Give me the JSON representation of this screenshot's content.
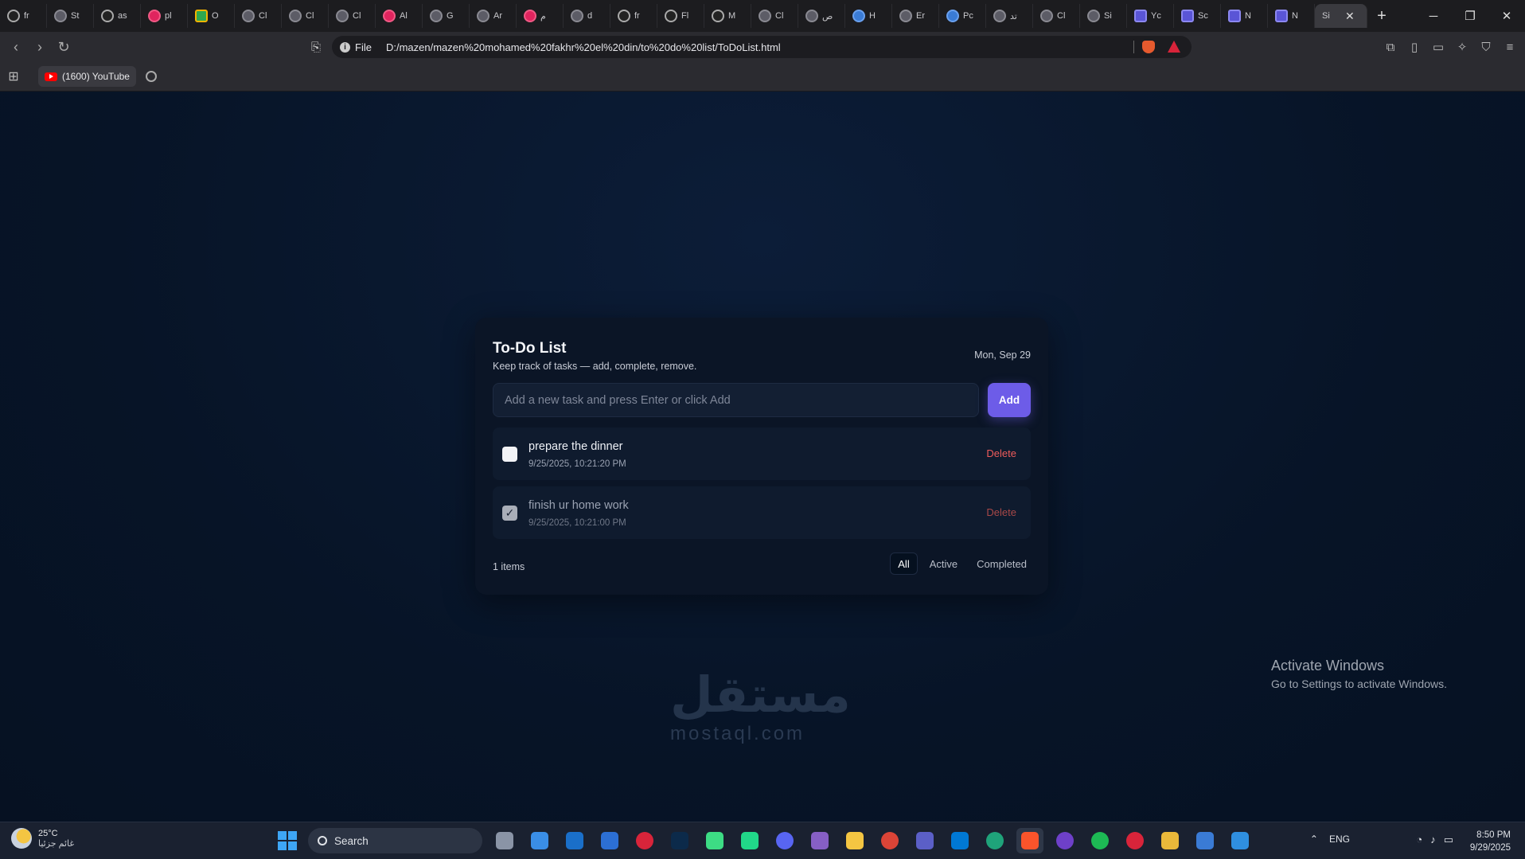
{
  "browser": {
    "tabs": [
      {
        "icon": "chatgpt-icon",
        "title": "fr"
      },
      {
        "icon": "openai-icon",
        "title": "St"
      },
      {
        "icon": "github-icon",
        "title": "as"
      },
      {
        "icon": "app-icon",
        "title": "pl"
      },
      {
        "icon": "drive-icon",
        "title": "O"
      },
      {
        "icon": "openai-icon",
        "title": "Cl"
      },
      {
        "icon": "openai-icon",
        "title": "Cl"
      },
      {
        "icon": "openai-icon",
        "title": "Cl"
      },
      {
        "icon": "instagram-icon",
        "title": "Al"
      },
      {
        "icon": "google-icon",
        "title": "G"
      },
      {
        "icon": "openai-icon",
        "title": "Ar"
      },
      {
        "icon": "gmail-icon",
        "title": "م"
      },
      {
        "icon": "openai-icon",
        "title": "d"
      },
      {
        "icon": "chatgpt-icon",
        "title": "fr"
      },
      {
        "icon": "shield-icon",
        "title": "Fl"
      },
      {
        "icon": "mountain-icon",
        "title": "M"
      },
      {
        "icon": "openai-icon",
        "title": "Cl"
      },
      {
        "icon": "openai-icon",
        "title": "ص"
      },
      {
        "icon": "copilot-icon",
        "title": "H"
      },
      {
        "icon": "openai-icon",
        "title": "Er"
      },
      {
        "icon": "copilot-icon",
        "title": "Pc"
      },
      {
        "icon": "openai-icon",
        "title": "تد"
      },
      {
        "icon": "openai-icon",
        "title": "Cl"
      },
      {
        "icon": "openai-icon",
        "title": "Si"
      },
      {
        "icon": "notes-icon",
        "title": "Yc"
      },
      {
        "icon": "notes-icon",
        "title": "Sc"
      },
      {
        "icon": "notes-icon",
        "title": "N"
      },
      {
        "icon": "notes-icon",
        "title": "N"
      }
    ],
    "active_tab_title": "Si",
    "url_scheme_label": "File",
    "url": "D:/mazen/mazen%20mohamed%20fakhr%20el%20din/to%20do%20list/ToDoList.html",
    "bookmark_youtube": "(1600) YouTube"
  },
  "app": {
    "title": "To-Do List",
    "subtitle": "Keep track of tasks — add, complete, remove.",
    "date": "Mon, Sep 29",
    "input_placeholder": "Add a new task and press Enter or click Add",
    "add_label": "Add",
    "tasks": [
      {
        "text": "prepare the dinner",
        "time": "9/25/2025, 10:21:20 PM",
        "done": false,
        "delete_label": "Delete"
      },
      {
        "text": "finish ur home work",
        "time": "9/25/2025, 10:21:00 PM",
        "done": true,
        "delete_label": "Delete"
      }
    ],
    "items_count": "1 items",
    "filters": [
      "All",
      "Active",
      "Completed"
    ],
    "active_filter": "All",
    "accent_color": "#6d5ce8",
    "delete_color": "#ef5b5b"
  },
  "overlay": {
    "activate_title": "Activate Windows",
    "activate_sub": "Go to Settings to activate Windows.",
    "watermark": "مستقل",
    "watermark_domain": "mostaql.com"
  },
  "taskbar": {
    "temperature": "25°C",
    "condition": "غائم جزئيا",
    "search_label": "Search",
    "language": "ENG",
    "time": "8:50 PM",
    "date": "9/29/2025"
  }
}
